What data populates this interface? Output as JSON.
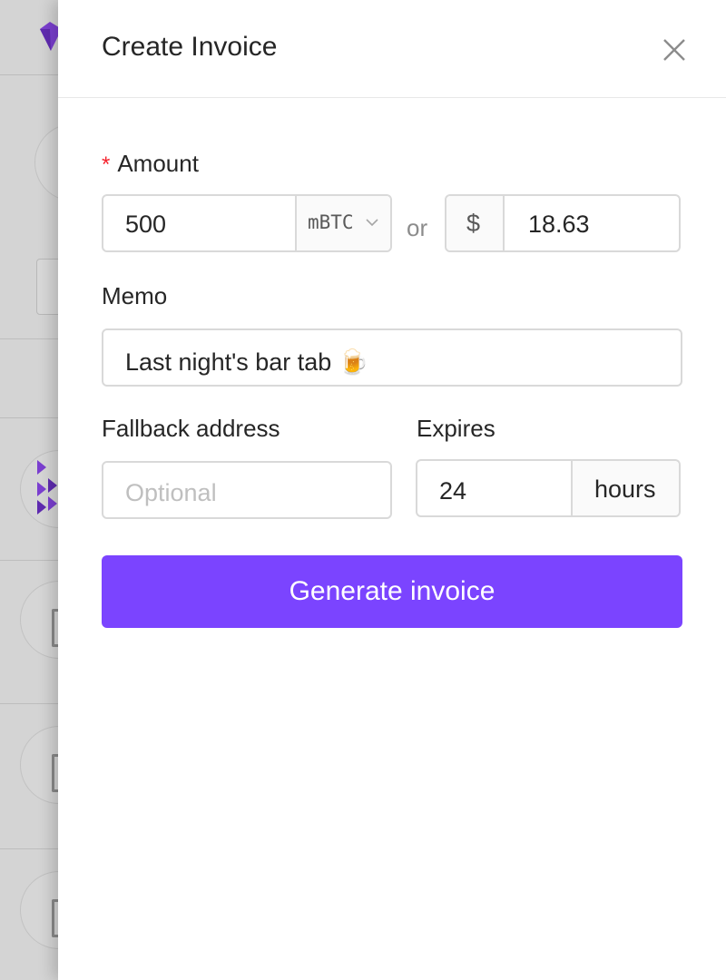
{
  "drawer": {
    "title": "Create Invoice"
  },
  "form": {
    "amount": {
      "required_mark": "*",
      "label": "Amount",
      "value": "500",
      "unit": "mBTC",
      "or_text": "or",
      "fiat_symbol": "$",
      "fiat_value": "18.63"
    },
    "memo": {
      "label": "Memo",
      "value": "Last night's bar tab 🍺"
    },
    "fallback": {
      "label": "Fallback address",
      "placeholder": "Optional"
    },
    "expires": {
      "label": "Expires",
      "value": "24",
      "unit": "hours"
    },
    "submit_label": "Generate invoice"
  },
  "colors": {
    "accent": "#7b44ff",
    "required": "#f5222d",
    "border": "#d9d9d9",
    "overlay": "#d4d4d4"
  },
  "icons": {
    "close": "close-icon",
    "dropdown": "chevron-down-icon",
    "logo": "gem-logo-icon"
  }
}
